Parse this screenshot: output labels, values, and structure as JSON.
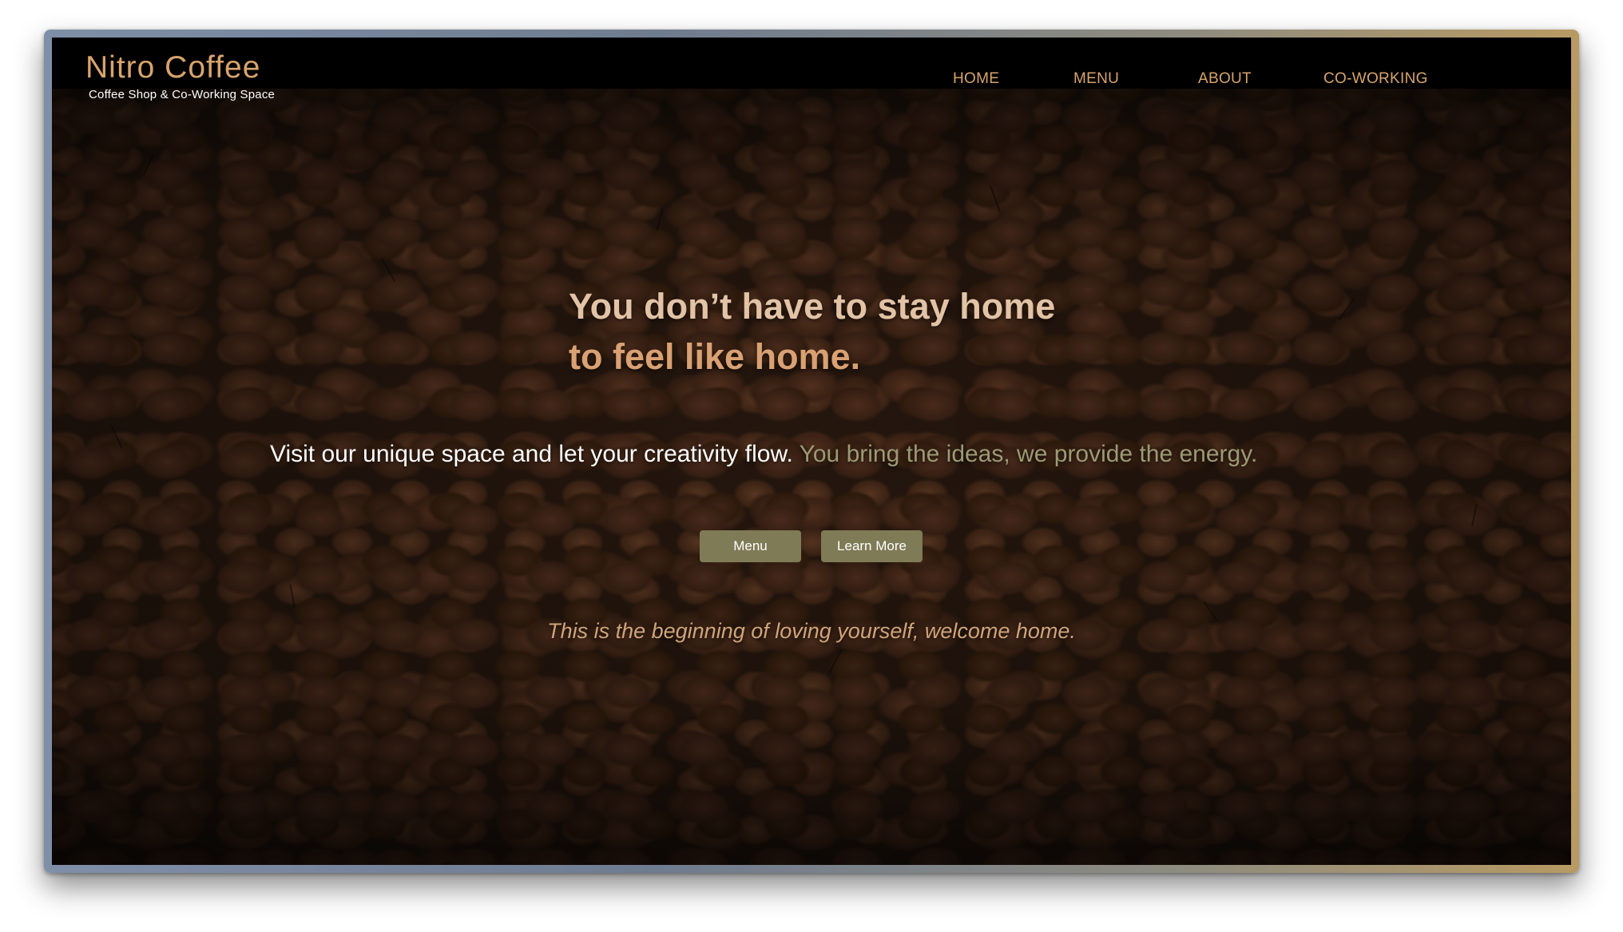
{
  "brand": {
    "title": "Nitro Coffee",
    "tagline": "Coffee Shop & Co-Working Space"
  },
  "nav": {
    "items": [
      {
        "label": "HOME"
      },
      {
        "label": "MENU"
      },
      {
        "label": "ABOUT"
      },
      {
        "label": "CO-WORKING"
      }
    ]
  },
  "hero": {
    "headline_line1": "You don’t have to stay home",
    "headline_line2": "to feel like home.",
    "subline_primary": "Visit our unique space and let your creativity flow.",
    "subline_secondary": " You bring the ideas, we provide the energy.",
    "buttons": {
      "menu_label": "Menu",
      "learn_more_label": "Learn More"
    },
    "tagline": "This is the beginning of loving yourself, welcome home."
  },
  "colors": {
    "accent": "#d7a46d",
    "button_bg": "#7f7b56",
    "muted_text": "#9c9a74",
    "navbar_bg": "#000000"
  }
}
